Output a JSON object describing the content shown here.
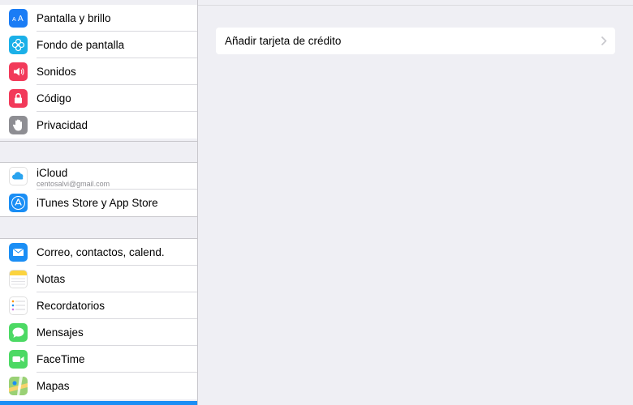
{
  "sidebar": {
    "group1": [
      {
        "label": "Pantalla y brillo",
        "icon": "display-brightness-icon",
        "color": "#1a7cf5"
      },
      {
        "label": "Fondo de pantalla",
        "icon": "wallpaper-flower-icon",
        "color": "#1bb0e8"
      },
      {
        "label": "Sonidos",
        "icon": "speaker-icon",
        "color": "#f23a5a"
      },
      {
        "label": "Código",
        "icon": "lock-icon",
        "color": "#f23a5a"
      },
      {
        "label": "Privacidad",
        "icon": "hand-icon",
        "color": "#8e8e93"
      }
    ],
    "group2": [
      {
        "label": "iCloud",
        "sublabel": "centosalvi@gmail.com",
        "icon": "icloud-icon",
        "color": "#ffffff"
      },
      {
        "label": "iTunes Store y App Store",
        "icon": "app-store-icon",
        "color": "#1a8ef5"
      }
    ],
    "group3": [
      {
        "label": "Correo, contactos, calend.",
        "icon": "mail-icon",
        "color": "#1a8ef5"
      },
      {
        "label": "Notas",
        "icon": "notes-icon",
        "color": "#fbd33f"
      },
      {
        "label": "Recordatorios",
        "icon": "reminders-icon",
        "color": "#ffffff"
      },
      {
        "label": "Mensajes",
        "icon": "messages-icon",
        "color": "#4cd964"
      },
      {
        "label": "FaceTime",
        "icon": "facetime-icon",
        "color": "#4cd964"
      },
      {
        "label": "Mapas",
        "icon": "maps-icon",
        "color": "#7ecb5a"
      }
    ]
  },
  "detail": {
    "add_card_label": "Añadir tarjeta de crédito"
  },
  "colors": {
    "background": "#efeff4",
    "selected_blue": "#1a8ef5"
  }
}
